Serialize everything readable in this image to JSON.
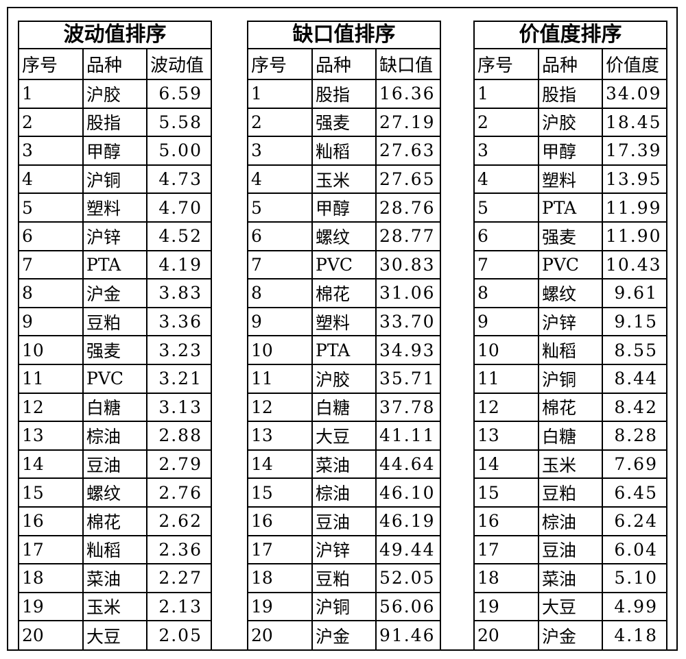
{
  "tables": [
    {
      "title": "波动值排序",
      "headers": [
        "序号",
        "品种",
        "波动值"
      ],
      "rows": [
        [
          "1",
          "沪胶",
          "6.59"
        ],
        [
          "2",
          "股指",
          "5.58"
        ],
        [
          "3",
          "甲醇",
          "5.00"
        ],
        [
          "4",
          "沪铜",
          "4.73"
        ],
        [
          "5",
          "塑料",
          "4.70"
        ],
        [
          "6",
          "沪锌",
          "4.52"
        ],
        [
          "7",
          "PTA",
          "4.19"
        ],
        [
          "8",
          "沪金",
          "3.83"
        ],
        [
          "9",
          "豆粕",
          "3.36"
        ],
        [
          "10",
          "强麦",
          "3.23"
        ],
        [
          "11",
          "PVC",
          "3.21"
        ],
        [
          "12",
          "白糖",
          "3.13"
        ],
        [
          "13",
          "棕油",
          "2.88"
        ],
        [
          "14",
          "豆油",
          "2.79"
        ],
        [
          "15",
          "螺纹",
          "2.76"
        ],
        [
          "16",
          "棉花",
          "2.62"
        ],
        [
          "17",
          "籼稻",
          "2.36"
        ],
        [
          "18",
          "菜油",
          "2.27"
        ],
        [
          "19",
          "玉米",
          "2.13"
        ],
        [
          "20",
          "大豆",
          "2.05"
        ]
      ]
    },
    {
      "title": "缺口值排序",
      "headers": [
        "序号",
        "品种",
        "缺口值"
      ],
      "rows": [
        [
          "1",
          "股指",
          "16.36"
        ],
        [
          "2",
          "强麦",
          "27.19"
        ],
        [
          "3",
          "籼稻",
          "27.63"
        ],
        [
          "4",
          "玉米",
          "27.65"
        ],
        [
          "5",
          "甲醇",
          "28.76"
        ],
        [
          "6",
          "螺纹",
          "28.77"
        ],
        [
          "7",
          "PVC",
          "30.83"
        ],
        [
          "8",
          "棉花",
          "31.06"
        ],
        [
          "9",
          "塑料",
          "33.70"
        ],
        [
          "10",
          "PTA",
          "34.93"
        ],
        [
          "11",
          "沪胶",
          "35.71"
        ],
        [
          "12",
          "白糖",
          "37.78"
        ],
        [
          "13",
          "大豆",
          "41.11"
        ],
        [
          "14",
          "菜油",
          "44.64"
        ],
        [
          "15",
          "棕油",
          "46.10"
        ],
        [
          "16",
          "豆油",
          "46.19"
        ],
        [
          "17",
          "沪锌",
          "49.44"
        ],
        [
          "18",
          "豆粕",
          "52.05"
        ],
        [
          "19",
          "沪铜",
          "56.06"
        ],
        [
          "20",
          "沪金",
          "91.46"
        ]
      ]
    },
    {
      "title": "价值度排序",
      "headers": [
        "序号",
        "品种",
        "价值度"
      ],
      "rows": [
        [
          "1",
          "股指",
          "34.09"
        ],
        [
          "2",
          "沪胶",
          "18.45"
        ],
        [
          "3",
          "甲醇",
          "17.39"
        ],
        [
          "4",
          "塑料",
          "13.95"
        ],
        [
          "5",
          "PTA",
          "11.99"
        ],
        [
          "6",
          "强麦",
          "11.90"
        ],
        [
          "7",
          "PVC",
          "10.43"
        ],
        [
          "8",
          "螺纹",
          "9.61"
        ],
        [
          "9",
          "沪锌",
          "9.15"
        ],
        [
          "10",
          "籼稻",
          "8.55"
        ],
        [
          "11",
          "沪铜",
          "8.44"
        ],
        [
          "12",
          "棉花",
          "8.42"
        ],
        [
          "13",
          "白糖",
          "8.28"
        ],
        [
          "14",
          "玉米",
          "7.69"
        ],
        [
          "15",
          "豆粕",
          "6.45"
        ],
        [
          "16",
          "棕油",
          "6.24"
        ],
        [
          "17",
          "豆油",
          "6.04"
        ],
        [
          "18",
          "菜油",
          "5.10"
        ],
        [
          "19",
          "大豆",
          "4.99"
        ],
        [
          "20",
          "沪金",
          "4.18"
        ]
      ]
    }
  ]
}
